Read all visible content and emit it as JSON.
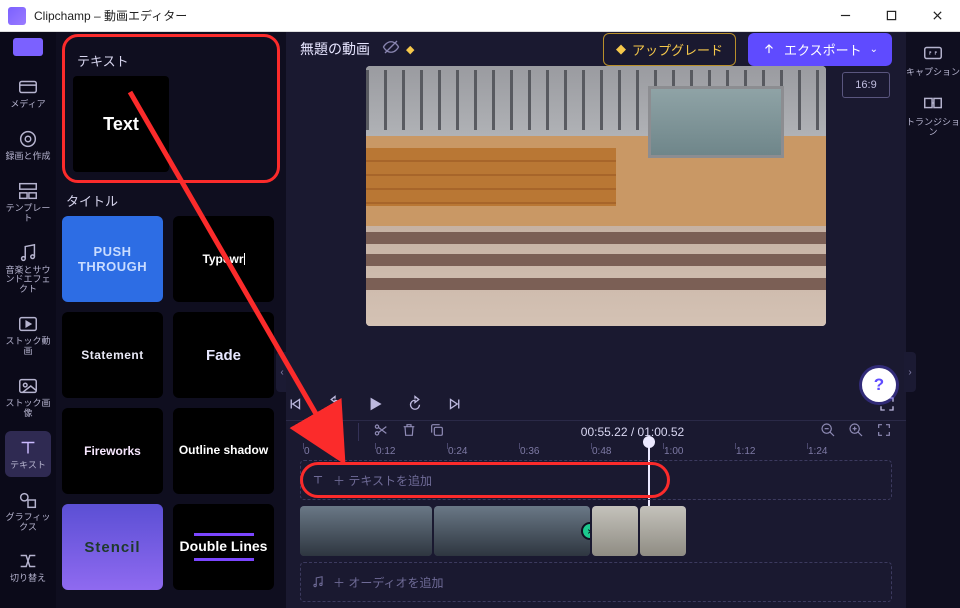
{
  "window": {
    "title": "Clipchamp – 動画エディター"
  },
  "nav": {
    "items": [
      {
        "label": "メディア"
      },
      {
        "label": "録画と作成"
      },
      {
        "label": "テンプレート"
      },
      {
        "label": "音楽とサウンドエフェクト"
      },
      {
        "label": "ストック動画"
      },
      {
        "label": "ストック画像"
      },
      {
        "label": "テキスト"
      },
      {
        "label": "グラフィックス"
      },
      {
        "label": "切り替え"
      }
    ]
  },
  "panel": {
    "group_text": "テキスト",
    "group_titles": "タイトル",
    "text_tile": "Text",
    "tiles": [
      "PUSH THROUGH",
      "Typewr",
      "Statement",
      "Fade",
      "Fireworks",
      "Outline shadow",
      "Stencil",
      "Double Lines"
    ]
  },
  "header": {
    "project_title": "無題の動画",
    "upgrade": "アップグレード",
    "export": "エクスポート"
  },
  "stage": {
    "aspect": "16:9"
  },
  "timeline": {
    "current": "00:55.22",
    "duration": "01:00.52",
    "ticks": [
      "0",
      "0:12",
      "0:24",
      "0:36",
      "0:48",
      "1:00",
      "1:12",
      "1:24"
    ],
    "add_text": "＋ テキストを追加",
    "add_audio": "＋ オーディオを追加"
  },
  "rightbar": {
    "captions": "キャプション",
    "transitions": "トランジション"
  }
}
